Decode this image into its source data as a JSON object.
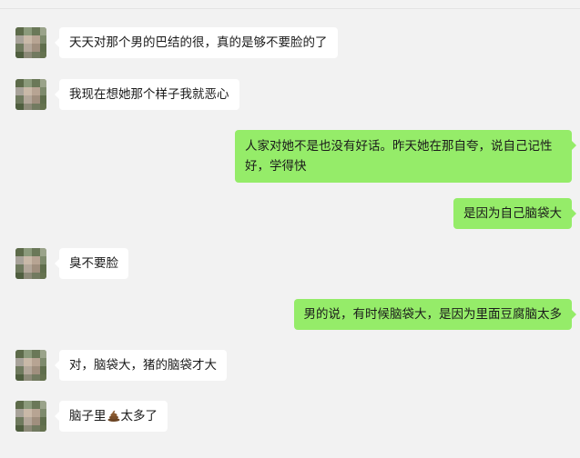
{
  "chat": {
    "messages": [
      {
        "side": "left",
        "text": "天天对那个男的巴结的很，真的是够不要脸的了"
      },
      {
        "side": "left",
        "text": "我现在想她那个样子我就恶心"
      },
      {
        "side": "right",
        "line1": "人家对她不是也没有好话。昨天她在那自夸，说自己记性",
        "line2": "好，学得快"
      },
      {
        "side": "right",
        "text": "是因为自己脑袋大"
      },
      {
        "side": "left",
        "text": "臭不要脸"
      },
      {
        "side": "right",
        "text": "男的说，有时候脑袋大，是因为里面豆腐脑太多"
      },
      {
        "side": "left",
        "text": "对，脑袋大，猪的脑袋才大"
      },
      {
        "side": "left",
        "before": "脑子里",
        "emoji": "poop-emoji",
        "after": "太多了"
      }
    ]
  },
  "colors": {
    "background": "#f2f2f2",
    "incoming_bubble": "#ffffff",
    "outgoing_bubble": "#95ec69",
    "text": "#1a1a1a"
  }
}
